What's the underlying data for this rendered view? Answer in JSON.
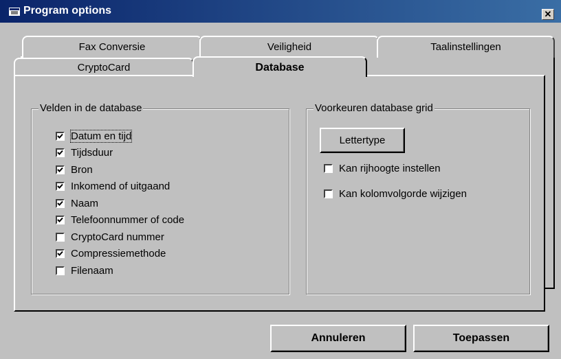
{
  "window": {
    "title": "Program options"
  },
  "tabs": {
    "fax": "Fax Conversie",
    "veiligheid": "Veiligheid",
    "taal": "Taalinstellingen",
    "cryptocard": "CryptoCard",
    "database": "Database"
  },
  "fields_group": {
    "legend": "Velden in de database",
    "items": [
      {
        "label": "Datum en tijd",
        "checked": true
      },
      {
        "label": "Tijdsduur",
        "checked": true
      },
      {
        "label": "Bron",
        "checked": true
      },
      {
        "label": "Inkomend of uitgaand",
        "checked": true
      },
      {
        "label": "Naam",
        "checked": true
      },
      {
        "label": "Telefoonnummer of code",
        "checked": true
      },
      {
        "label": "CryptoCard nummer",
        "checked": false
      },
      {
        "label": "Compressiemethode",
        "checked": true
      },
      {
        "label": "Filenaam",
        "checked": false
      }
    ]
  },
  "grid_group": {
    "legend": "Voorkeuren database grid",
    "font_button": "Lettertype",
    "options": [
      {
        "label": "Kan rijhoogte instellen",
        "checked": false
      },
      {
        "label": "Kan kolomvolgorde wijzigen",
        "checked": false
      }
    ]
  },
  "footer": {
    "cancel": "Annuleren",
    "apply": "Toepassen"
  },
  "colors": {
    "titlebar_start": "#0a246a",
    "titlebar_end": "#3a6ea5",
    "face": "#c0c0c0"
  }
}
